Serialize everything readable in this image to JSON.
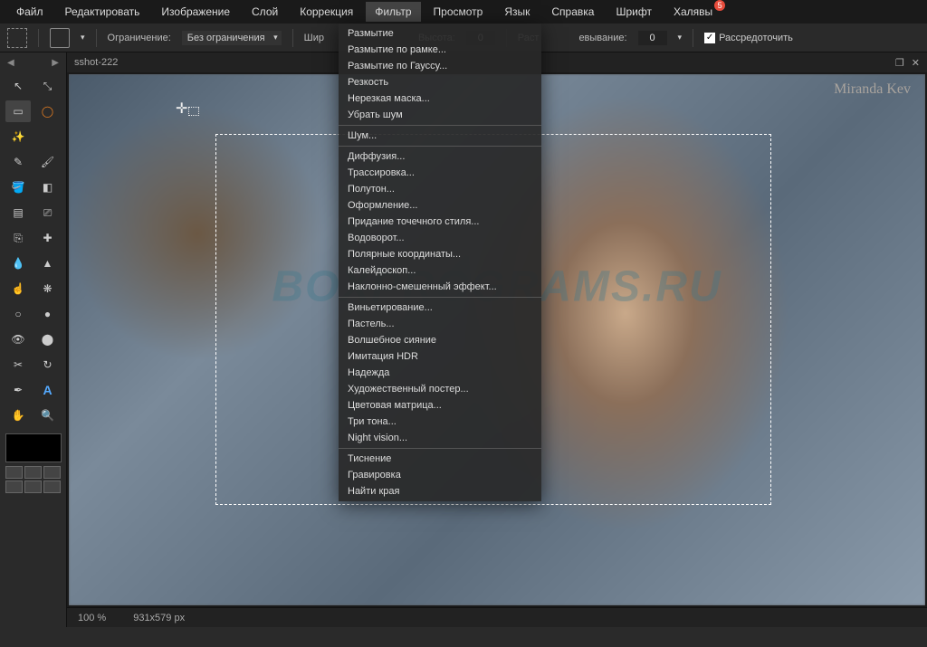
{
  "menubar": {
    "items": [
      "Файл",
      "Редактировать",
      "Изображение",
      "Слой",
      "Коррекция",
      "Фильтр",
      "Просмотр",
      "Язык",
      "Справка",
      "Шрифт",
      "Халявы"
    ],
    "active_index": 5,
    "badge_index": 10,
    "badge_value": "5"
  },
  "toolbar": {
    "constraint_label": "Ограничение:",
    "constraint_value": "Без ограничения",
    "width_label": "Шир",
    "height_label": "Высота:",
    "height_value": "0",
    "blur_label": "Раст",
    "feather_label": "евывание:",
    "feather_value": "0",
    "scatter_label": "Рассредоточить"
  },
  "tab": {
    "title": "sshot-222",
    "restore_icon": "❐",
    "close_icon": "✕"
  },
  "canvas": {
    "watermark": "BOXPROGRAMS.RU",
    "signature": "Miranda Kev"
  },
  "filter_menu": {
    "groups": [
      [
        "Размытие",
        "Размытие по рамке...",
        "Размытие по Гауссу...",
        "Резкость",
        "Нерезкая маска...",
        "Убрать шум"
      ],
      [
        "Шум..."
      ],
      [
        "Диффузия...",
        "Трассировка...",
        "Полутон...",
        "Оформление...",
        "Придание точечного стиля...",
        "Водоворот...",
        "Полярные координаты...",
        "Калейдоскоп...",
        "Наклонно-смешенный эффект..."
      ],
      [
        "Виньетирование...",
        "Пастель...",
        "Волшебное сияние",
        "Имитация HDR",
        "Надежда",
        "Художественный постер...",
        "Цветовая матрица...",
        "Три тона...",
        "Night vision..."
      ],
      [
        "Тиснение",
        "Гравировка",
        "Найти края"
      ]
    ]
  },
  "status": {
    "zoom": "100 %",
    "dimensions": "931x579 px"
  },
  "tools": [
    {
      "name": "move",
      "glyph": "↖"
    },
    {
      "name": "move-alt",
      "glyph": "⤡"
    },
    {
      "name": "marquee",
      "glyph": "▭"
    },
    {
      "name": "lasso",
      "glyph": "◯"
    },
    {
      "name": "wand",
      "glyph": "✨"
    },
    {
      "name": "spacer1",
      "glyph": ""
    },
    {
      "name": "pencil",
      "glyph": "✎"
    },
    {
      "name": "brush",
      "glyph": "🖌"
    },
    {
      "name": "bucket",
      "glyph": "🪣"
    },
    {
      "name": "eraser",
      "glyph": "◧"
    },
    {
      "name": "gradient",
      "glyph": "▤"
    },
    {
      "name": "stamp",
      "glyph": "⎚"
    },
    {
      "name": "clone",
      "glyph": "⎘"
    },
    {
      "name": "heal",
      "glyph": "✚"
    },
    {
      "name": "drop",
      "glyph": "💧"
    },
    {
      "name": "shape",
      "glyph": "▲"
    },
    {
      "name": "smudge",
      "glyph": "☝"
    },
    {
      "name": "sponge",
      "glyph": "❋"
    },
    {
      "name": "dodge",
      "glyph": "○"
    },
    {
      "name": "burn",
      "glyph": "●"
    },
    {
      "name": "redeye",
      "glyph": "👁"
    },
    {
      "name": "color-rep",
      "glyph": "⬤"
    },
    {
      "name": "crop",
      "glyph": "✂"
    },
    {
      "name": "rotate",
      "glyph": "↻"
    },
    {
      "name": "pen",
      "glyph": "✒"
    },
    {
      "name": "text",
      "glyph": "A"
    },
    {
      "name": "hand",
      "glyph": "✋"
    },
    {
      "name": "zoom",
      "glyph": "🔍"
    }
  ]
}
